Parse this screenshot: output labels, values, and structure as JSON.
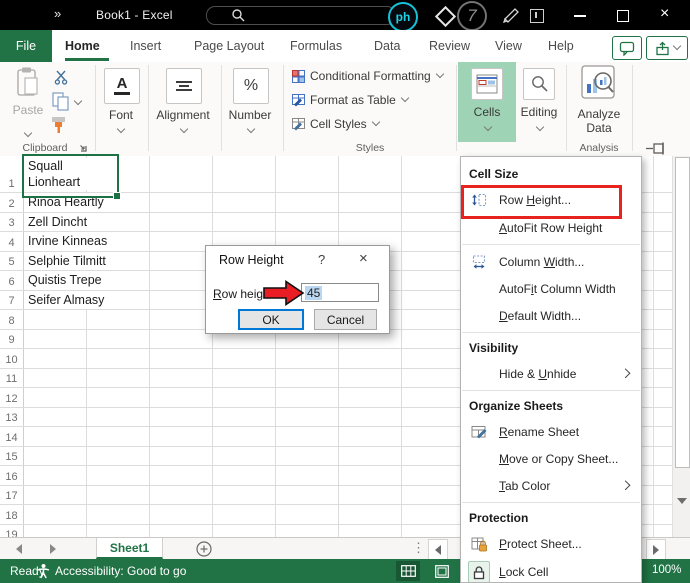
{
  "colors": {
    "excel_green": "#217346",
    "cells_active_bg": "#9fd3b5",
    "selection_border": "#1e7145",
    "annotation_red": "#e8231f",
    "focus_blue": "#0078d7",
    "text_selection_bg": "#b9d7f0",
    "titlebar_bg": "#000000"
  },
  "titlebar": {
    "chevron": "»",
    "title": "Book1  -  Excel",
    "watermark_logo": "ph",
    "watermark_number": "7"
  },
  "tabs": {
    "file": "File",
    "items": [
      "Home",
      "Insert",
      "Page Layout",
      "Formulas",
      "Data",
      "Review",
      "View",
      "Help"
    ],
    "active": "Home"
  },
  "ribbon": {
    "clipboard": {
      "paste": "Paste",
      "group": "Clipboard"
    },
    "font": {
      "glyph": "A",
      "label": "Font"
    },
    "alignment": {
      "label": "Alignment"
    },
    "number": {
      "glyph": "%",
      "label": "Number"
    },
    "styles": {
      "conditional": "Conditional Formatting",
      "table": "Format as Table",
      "cellstyles": "Cell Styles",
      "group": "Styles"
    },
    "cells": {
      "label": "Cells"
    },
    "editing": {
      "label": "Editing"
    },
    "analysis": {
      "button_line1": "Analyze",
      "button_line2": "Data",
      "group": "Analysis"
    }
  },
  "sheet": {
    "rows": [
      {
        "num": "1",
        "name": "Squall Lionheart"
      },
      {
        "num": "2",
        "name": "Rinoa Heartly"
      },
      {
        "num": "3",
        "name": "Zell Dincht"
      },
      {
        "num": "4",
        "name": "Irvine Kinneas"
      },
      {
        "num": "5",
        "name": "Selphie Tilmitt"
      },
      {
        "num": "6",
        "name": "Quistis Trepe"
      },
      {
        "num": "7",
        "name": "Seifer Almasy"
      },
      {
        "num": "8",
        "name": ""
      },
      {
        "num": "9",
        "name": ""
      },
      {
        "num": "10",
        "name": ""
      },
      {
        "num": "11",
        "name": ""
      },
      {
        "num": "12",
        "name": ""
      },
      {
        "num": "13",
        "name": ""
      },
      {
        "num": "14",
        "name": ""
      },
      {
        "num": "15",
        "name": ""
      },
      {
        "num": "16",
        "name": ""
      },
      {
        "num": "17",
        "name": ""
      },
      {
        "num": "18",
        "name": ""
      },
      {
        "num": "19",
        "name": ""
      }
    ]
  },
  "dialog": {
    "title": "Row Height",
    "help": "?",
    "close": "×",
    "label": {
      "key": "R",
      "post": "ow height:"
    },
    "value": "45",
    "ok": "OK",
    "cancel": "Cancel"
  },
  "format_menu": {
    "sections": [
      {
        "header": "Cell Size",
        "items": [
          {
            "pre": "Row ",
            "key": "H",
            "post": "eight..."
          },
          {
            "pre": "",
            "key": "A",
            "post": "utoFit Row Height"
          },
          {
            "pre": "Column ",
            "key": "W",
            "post": "idth..."
          },
          {
            "pre": "AutoF",
            "key": "i",
            "post": "t Column Width"
          },
          {
            "pre": "",
            "key": "D",
            "post": "efault Width..."
          }
        ]
      },
      {
        "header": "Visibility",
        "items": [
          {
            "pre": "Hide & ",
            "key": "U",
            "post": "nhide"
          }
        ]
      },
      {
        "header": "Organize Sheets",
        "items": [
          {
            "pre": "",
            "key": "R",
            "post": "ename Sheet"
          },
          {
            "pre": "",
            "key": "M",
            "post": "ove or Copy Sheet..."
          },
          {
            "pre": "",
            "key": "T",
            "post": "ab Color"
          }
        ]
      },
      {
        "header": "Protection",
        "items": [
          {
            "pre": "",
            "key": "P",
            "post": "rotect Sheet..."
          },
          {
            "pre": "",
            "key": "L",
            "post": "ock Cell"
          }
        ]
      }
    ]
  },
  "sheet_tabs": {
    "active": "Sheet1"
  },
  "status": {
    "ready": "Ready",
    "accessibility": "Accessibility: Good to go",
    "zoom": "100%"
  }
}
